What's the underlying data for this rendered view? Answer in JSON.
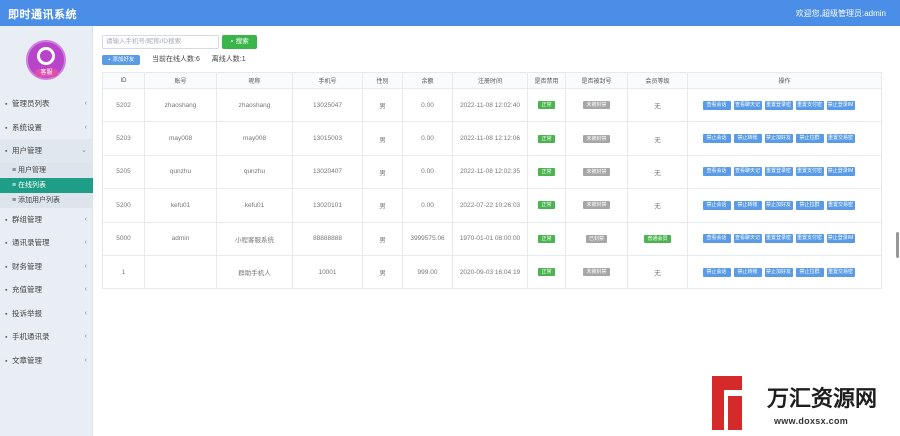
{
  "app": {
    "title": "即时通讯系统",
    "user": "欢迎您,超级管理员:admin"
  },
  "sidebar": {
    "avatar_badge": "客服",
    "items": [
      {
        "label": "管理员列表",
        "icon": "user-icon",
        "open": false
      },
      {
        "label": "系统设置",
        "icon": "gear-icon",
        "open": false
      },
      {
        "label": "用户管理",
        "icon": "users-icon",
        "open": true,
        "children": [
          {
            "label": "用户管理",
            "active": false
          },
          {
            "label": "在线列表",
            "active": true
          },
          {
            "label": "添加用户列表",
            "active": false
          }
        ]
      },
      {
        "label": "群组管理",
        "icon": "group-icon",
        "open": false
      },
      {
        "label": "通讯录管理",
        "icon": "contacts-icon",
        "open": false
      },
      {
        "label": "财务管理",
        "icon": "finance-icon",
        "open": false
      },
      {
        "label": "充值管理",
        "icon": "recharge-icon",
        "open": false
      },
      {
        "label": "投诉举报",
        "icon": "report-icon",
        "open": false
      },
      {
        "label": "手机通讯录",
        "icon": "phone-icon",
        "open": false
      },
      {
        "label": "文章管理",
        "icon": "article-icon",
        "open": false
      }
    ]
  },
  "toolbar": {
    "search_placeholder": "请输入手机号/昵称/ID搜索",
    "search_button": "搜索",
    "add_button": "+ 添加好友",
    "online_label": "当前在线人数:6",
    "offline_label": "离线人数:1"
  },
  "table": {
    "headers": [
      "ID",
      "账号",
      "昵称",
      "手机号",
      "性别",
      "余额",
      "注册时间",
      "是否禁用",
      "是否被封号",
      "会员等级",
      "操作"
    ],
    "rows": [
      {
        "cells": [
          "5202",
          "zhaoshang",
          "zhaoshang",
          "13025047",
          "男",
          "0.00",
          "2022-11-08 12:02:40"
        ],
        "status": "正常",
        "status_color": "green",
        "ban": "未被封禁",
        "vip": "无",
        "ops": [
          "查看会话",
          "查看聊天记录",
          "重置登录密码",
          "重置支付密码",
          "禁止登录IM"
        ]
      },
      {
        "cells": [
          "5203",
          "may008",
          "may008",
          "13015003",
          "男",
          "0.00",
          "2022-11-08 12:12:06"
        ],
        "status": "正常",
        "status_color": "green",
        "ban": "未被封禁",
        "vip": "无",
        "ops": [
          "禁止会话",
          "禁止转账",
          "禁止加好友",
          "禁止拉群",
          "重置交易密码"
        ]
      },
      {
        "cells": [
          "5205",
          "qunzhu",
          "qunzhu",
          "13020407",
          "男",
          "0.00",
          "2022-11-08 12:02:35"
        ],
        "status": "正常",
        "status_color": "green",
        "ban": "未被封禁",
        "vip": "无",
        "ops": [
          "查看会话",
          "查看聊天记录",
          "重置登录密码",
          "重置支付密码",
          "禁止登录IM"
        ]
      },
      {
        "cells": [
          "5200",
          "kefu01",
          "kefu01",
          "13020101",
          "男",
          "0.00",
          "2022-07-22 10:26:03"
        ],
        "status": "正常",
        "status_color": "green",
        "ban": "未被封禁",
        "vip": "无",
        "ops": [
          "禁止会话",
          "禁止转账",
          "禁止加好友",
          "禁止拉群",
          "重置交易密码"
        ]
      },
      {
        "cells": [
          "5000",
          "admin",
          "小程客服系统",
          "88888888",
          "男",
          "3999575.06",
          "1970-01-01 08:00:00"
        ],
        "status": "正常",
        "status_color": "green",
        "ban": "已封禁",
        "vip": "普通会员",
        "ops": [
          "查看会话",
          "查看聊天记录",
          "重置登录密码",
          "重置支付密码",
          "禁止登录IM"
        ]
      },
      {
        "cells": [
          "1",
          "",
          "群助手机人",
          "10001",
          "男",
          "999.00",
          "2020-09-03 16:04:19"
        ],
        "status": "正常",
        "status_color": "green",
        "ban": "未被封禁",
        "vip": "无",
        "ops": [
          "禁止会话",
          "禁止转账",
          "禁止加好友",
          "禁止拉群",
          "重置交易密码"
        ]
      }
    ]
  },
  "watermark": {
    "name": "万汇资源网",
    "url": "www.doxsx.com"
  },
  "colors": {
    "primary": "#4a8ee8",
    "sidebar_active": "#1f9e87",
    "success": "#3ab54a",
    "tag_gray": "#a6a6a6",
    "watermark_red": "#d42a2a"
  }
}
